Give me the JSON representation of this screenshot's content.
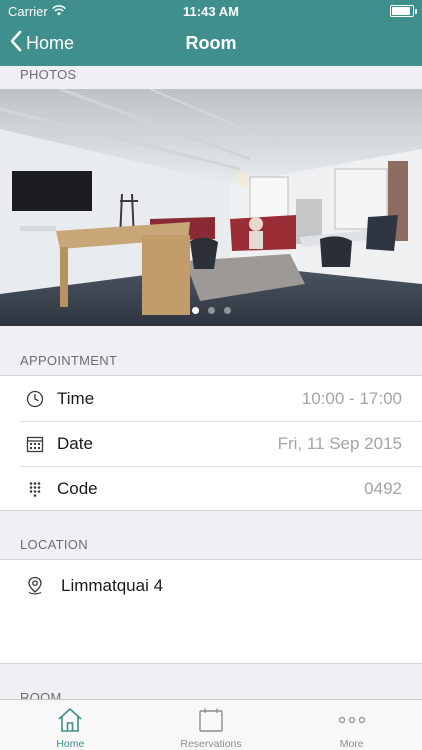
{
  "status_bar": {
    "carrier": "Carrier",
    "time": "11:43 AM",
    "battery_level": 0.9
  },
  "nav": {
    "back_label": "Home",
    "title": "Room"
  },
  "photos": {
    "header": "PHOTOS",
    "page_count": 3,
    "current_page": 0
  },
  "appointment": {
    "header": "APPOINTMENT",
    "rows": [
      {
        "icon": "clock-icon",
        "label": "Time",
        "value": "10:00 - 17:00"
      },
      {
        "icon": "calendar-icon",
        "label": "Date",
        "value": "Fri, 11 Sep 2015"
      },
      {
        "icon": "keypad-icon",
        "label": "Code",
        "value": "0492"
      }
    ]
  },
  "location": {
    "header": "LOCATION",
    "icon": "location-pin-icon",
    "address": "Limmatquai 4"
  },
  "room": {
    "header": "ROOM"
  },
  "tab_bar": {
    "tabs": [
      {
        "label": "Home",
        "icon": "house-icon",
        "active": true
      },
      {
        "label": "Reservations",
        "icon": "calendar-icon",
        "active": false
      },
      {
        "label": "More",
        "icon": "more-dots-icon",
        "active": false
      }
    ]
  },
  "colors": {
    "accent": "#3f8f8c",
    "background": "#efeff4",
    "secondary_text": "#a4a4a8"
  }
}
